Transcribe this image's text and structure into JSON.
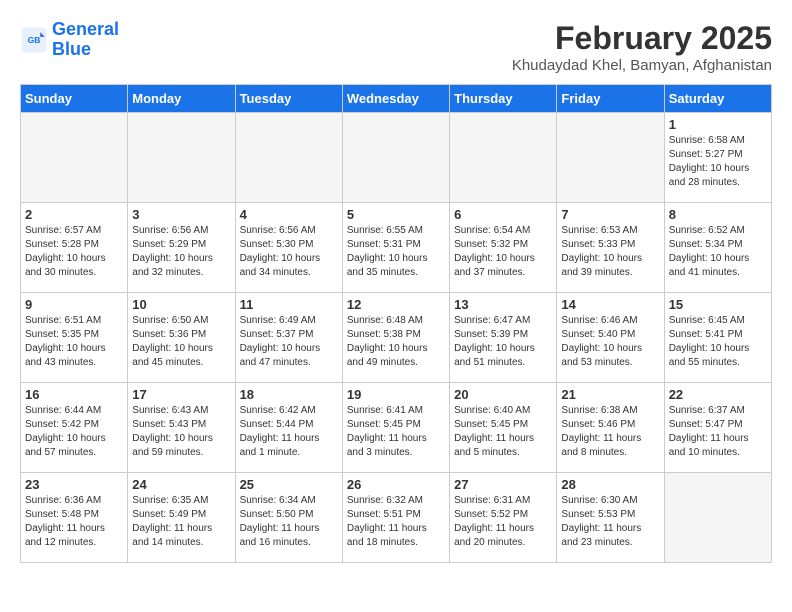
{
  "header": {
    "logo_line1": "General",
    "logo_line2": "Blue",
    "month_year": "February 2025",
    "location": "Khudaydad Khel, Bamyan, Afghanistan"
  },
  "weekdays": [
    "Sunday",
    "Monday",
    "Tuesday",
    "Wednesday",
    "Thursday",
    "Friday",
    "Saturday"
  ],
  "weeks": [
    [
      {
        "day": "",
        "info": ""
      },
      {
        "day": "",
        "info": ""
      },
      {
        "day": "",
        "info": ""
      },
      {
        "day": "",
        "info": ""
      },
      {
        "day": "",
        "info": ""
      },
      {
        "day": "",
        "info": ""
      },
      {
        "day": "1",
        "info": "Sunrise: 6:58 AM\nSunset: 5:27 PM\nDaylight: 10 hours and 28 minutes."
      }
    ],
    [
      {
        "day": "2",
        "info": "Sunrise: 6:57 AM\nSunset: 5:28 PM\nDaylight: 10 hours and 30 minutes."
      },
      {
        "day": "3",
        "info": "Sunrise: 6:56 AM\nSunset: 5:29 PM\nDaylight: 10 hours and 32 minutes."
      },
      {
        "day": "4",
        "info": "Sunrise: 6:56 AM\nSunset: 5:30 PM\nDaylight: 10 hours and 34 minutes."
      },
      {
        "day": "5",
        "info": "Sunrise: 6:55 AM\nSunset: 5:31 PM\nDaylight: 10 hours and 35 minutes."
      },
      {
        "day": "6",
        "info": "Sunrise: 6:54 AM\nSunset: 5:32 PM\nDaylight: 10 hours and 37 minutes."
      },
      {
        "day": "7",
        "info": "Sunrise: 6:53 AM\nSunset: 5:33 PM\nDaylight: 10 hours and 39 minutes."
      },
      {
        "day": "8",
        "info": "Sunrise: 6:52 AM\nSunset: 5:34 PM\nDaylight: 10 hours and 41 minutes."
      }
    ],
    [
      {
        "day": "9",
        "info": "Sunrise: 6:51 AM\nSunset: 5:35 PM\nDaylight: 10 hours and 43 minutes."
      },
      {
        "day": "10",
        "info": "Sunrise: 6:50 AM\nSunset: 5:36 PM\nDaylight: 10 hours and 45 minutes."
      },
      {
        "day": "11",
        "info": "Sunrise: 6:49 AM\nSunset: 5:37 PM\nDaylight: 10 hours and 47 minutes."
      },
      {
        "day": "12",
        "info": "Sunrise: 6:48 AM\nSunset: 5:38 PM\nDaylight: 10 hours and 49 minutes."
      },
      {
        "day": "13",
        "info": "Sunrise: 6:47 AM\nSunset: 5:39 PM\nDaylight: 10 hours and 51 minutes."
      },
      {
        "day": "14",
        "info": "Sunrise: 6:46 AM\nSunset: 5:40 PM\nDaylight: 10 hours and 53 minutes."
      },
      {
        "day": "15",
        "info": "Sunrise: 6:45 AM\nSunset: 5:41 PM\nDaylight: 10 hours and 55 minutes."
      }
    ],
    [
      {
        "day": "16",
        "info": "Sunrise: 6:44 AM\nSunset: 5:42 PM\nDaylight: 10 hours and 57 minutes."
      },
      {
        "day": "17",
        "info": "Sunrise: 6:43 AM\nSunset: 5:43 PM\nDaylight: 10 hours and 59 minutes."
      },
      {
        "day": "18",
        "info": "Sunrise: 6:42 AM\nSunset: 5:44 PM\nDaylight: 11 hours and 1 minute."
      },
      {
        "day": "19",
        "info": "Sunrise: 6:41 AM\nSunset: 5:45 PM\nDaylight: 11 hours and 3 minutes."
      },
      {
        "day": "20",
        "info": "Sunrise: 6:40 AM\nSunset: 5:45 PM\nDaylight: 11 hours and 5 minutes."
      },
      {
        "day": "21",
        "info": "Sunrise: 6:38 AM\nSunset: 5:46 PM\nDaylight: 11 hours and 8 minutes."
      },
      {
        "day": "22",
        "info": "Sunrise: 6:37 AM\nSunset: 5:47 PM\nDaylight: 11 hours and 10 minutes."
      }
    ],
    [
      {
        "day": "23",
        "info": "Sunrise: 6:36 AM\nSunset: 5:48 PM\nDaylight: 11 hours and 12 minutes."
      },
      {
        "day": "24",
        "info": "Sunrise: 6:35 AM\nSunset: 5:49 PM\nDaylight: 11 hours and 14 minutes."
      },
      {
        "day": "25",
        "info": "Sunrise: 6:34 AM\nSunset: 5:50 PM\nDaylight: 11 hours and 16 minutes."
      },
      {
        "day": "26",
        "info": "Sunrise: 6:32 AM\nSunset: 5:51 PM\nDaylight: 11 hours and 18 minutes."
      },
      {
        "day": "27",
        "info": "Sunrise: 6:31 AM\nSunset: 5:52 PM\nDaylight: 11 hours and 20 minutes."
      },
      {
        "day": "28",
        "info": "Sunrise: 6:30 AM\nSunset: 5:53 PM\nDaylight: 11 hours and 23 minutes."
      },
      {
        "day": "",
        "info": ""
      }
    ]
  ]
}
